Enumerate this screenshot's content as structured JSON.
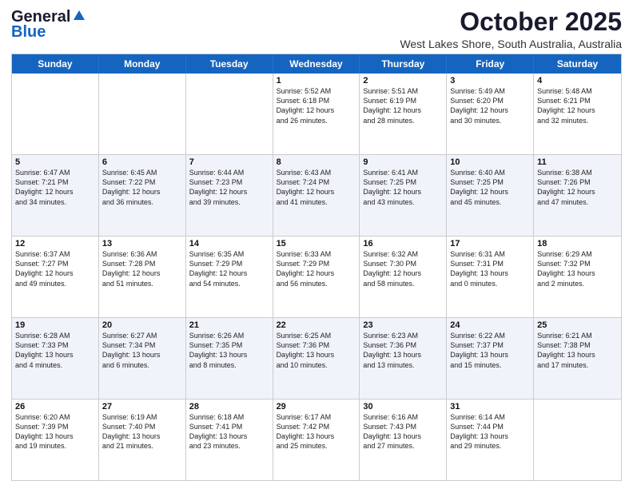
{
  "logo": {
    "line1": "General",
    "line2": "Blue"
  },
  "title": "October 2025",
  "subtitle": "West Lakes Shore, South Australia, Australia",
  "header_days": [
    "Sunday",
    "Monday",
    "Tuesday",
    "Wednesday",
    "Thursday",
    "Friday",
    "Saturday"
  ],
  "rows": [
    {
      "alt": false,
      "cells": [
        {
          "day": "",
          "lines": []
        },
        {
          "day": "",
          "lines": []
        },
        {
          "day": "",
          "lines": []
        },
        {
          "day": "1",
          "lines": [
            "Sunrise: 5:52 AM",
            "Sunset: 6:18 PM",
            "Daylight: 12 hours",
            "and 26 minutes."
          ]
        },
        {
          "day": "2",
          "lines": [
            "Sunrise: 5:51 AM",
            "Sunset: 6:19 PM",
            "Daylight: 12 hours",
            "and 28 minutes."
          ]
        },
        {
          "day": "3",
          "lines": [
            "Sunrise: 5:49 AM",
            "Sunset: 6:20 PM",
            "Daylight: 12 hours",
            "and 30 minutes."
          ]
        },
        {
          "day": "4",
          "lines": [
            "Sunrise: 5:48 AM",
            "Sunset: 6:21 PM",
            "Daylight: 12 hours",
            "and 32 minutes."
          ]
        }
      ]
    },
    {
      "alt": true,
      "cells": [
        {
          "day": "5",
          "lines": [
            "Sunrise: 6:47 AM",
            "Sunset: 7:21 PM",
            "Daylight: 12 hours",
            "and 34 minutes."
          ]
        },
        {
          "day": "6",
          "lines": [
            "Sunrise: 6:45 AM",
            "Sunset: 7:22 PM",
            "Daylight: 12 hours",
            "and 36 minutes."
          ]
        },
        {
          "day": "7",
          "lines": [
            "Sunrise: 6:44 AM",
            "Sunset: 7:23 PM",
            "Daylight: 12 hours",
            "and 39 minutes."
          ]
        },
        {
          "day": "8",
          "lines": [
            "Sunrise: 6:43 AM",
            "Sunset: 7:24 PM",
            "Daylight: 12 hours",
            "and 41 minutes."
          ]
        },
        {
          "day": "9",
          "lines": [
            "Sunrise: 6:41 AM",
            "Sunset: 7:25 PM",
            "Daylight: 12 hours",
            "and 43 minutes."
          ]
        },
        {
          "day": "10",
          "lines": [
            "Sunrise: 6:40 AM",
            "Sunset: 7:25 PM",
            "Daylight: 12 hours",
            "and 45 minutes."
          ]
        },
        {
          "day": "11",
          "lines": [
            "Sunrise: 6:38 AM",
            "Sunset: 7:26 PM",
            "Daylight: 12 hours",
            "and 47 minutes."
          ]
        }
      ]
    },
    {
      "alt": false,
      "cells": [
        {
          "day": "12",
          "lines": [
            "Sunrise: 6:37 AM",
            "Sunset: 7:27 PM",
            "Daylight: 12 hours",
            "and 49 minutes."
          ]
        },
        {
          "day": "13",
          "lines": [
            "Sunrise: 6:36 AM",
            "Sunset: 7:28 PM",
            "Daylight: 12 hours",
            "and 51 minutes."
          ]
        },
        {
          "day": "14",
          "lines": [
            "Sunrise: 6:35 AM",
            "Sunset: 7:29 PM",
            "Daylight: 12 hours",
            "and 54 minutes."
          ]
        },
        {
          "day": "15",
          "lines": [
            "Sunrise: 6:33 AM",
            "Sunset: 7:29 PM",
            "Daylight: 12 hours",
            "and 56 minutes."
          ]
        },
        {
          "day": "16",
          "lines": [
            "Sunrise: 6:32 AM",
            "Sunset: 7:30 PM",
            "Daylight: 12 hours",
            "and 58 minutes."
          ]
        },
        {
          "day": "17",
          "lines": [
            "Sunrise: 6:31 AM",
            "Sunset: 7:31 PM",
            "Daylight: 13 hours",
            "and 0 minutes."
          ]
        },
        {
          "day": "18",
          "lines": [
            "Sunrise: 6:29 AM",
            "Sunset: 7:32 PM",
            "Daylight: 13 hours",
            "and 2 minutes."
          ]
        }
      ]
    },
    {
      "alt": true,
      "cells": [
        {
          "day": "19",
          "lines": [
            "Sunrise: 6:28 AM",
            "Sunset: 7:33 PM",
            "Daylight: 13 hours",
            "and 4 minutes."
          ]
        },
        {
          "day": "20",
          "lines": [
            "Sunrise: 6:27 AM",
            "Sunset: 7:34 PM",
            "Daylight: 13 hours",
            "and 6 minutes."
          ]
        },
        {
          "day": "21",
          "lines": [
            "Sunrise: 6:26 AM",
            "Sunset: 7:35 PM",
            "Daylight: 13 hours",
            "and 8 minutes."
          ]
        },
        {
          "day": "22",
          "lines": [
            "Sunrise: 6:25 AM",
            "Sunset: 7:36 PM",
            "Daylight: 13 hours",
            "and 10 minutes."
          ]
        },
        {
          "day": "23",
          "lines": [
            "Sunrise: 6:23 AM",
            "Sunset: 7:36 PM",
            "Daylight: 13 hours",
            "and 13 minutes."
          ]
        },
        {
          "day": "24",
          "lines": [
            "Sunrise: 6:22 AM",
            "Sunset: 7:37 PM",
            "Daylight: 13 hours",
            "and 15 minutes."
          ]
        },
        {
          "day": "25",
          "lines": [
            "Sunrise: 6:21 AM",
            "Sunset: 7:38 PM",
            "Daylight: 13 hours",
            "and 17 minutes."
          ]
        }
      ]
    },
    {
      "alt": false,
      "cells": [
        {
          "day": "26",
          "lines": [
            "Sunrise: 6:20 AM",
            "Sunset: 7:39 PM",
            "Daylight: 13 hours",
            "and 19 minutes."
          ]
        },
        {
          "day": "27",
          "lines": [
            "Sunrise: 6:19 AM",
            "Sunset: 7:40 PM",
            "Daylight: 13 hours",
            "and 21 minutes."
          ]
        },
        {
          "day": "28",
          "lines": [
            "Sunrise: 6:18 AM",
            "Sunset: 7:41 PM",
            "Daylight: 13 hours",
            "and 23 minutes."
          ]
        },
        {
          "day": "29",
          "lines": [
            "Sunrise: 6:17 AM",
            "Sunset: 7:42 PM",
            "Daylight: 13 hours",
            "and 25 minutes."
          ]
        },
        {
          "day": "30",
          "lines": [
            "Sunrise: 6:16 AM",
            "Sunset: 7:43 PM",
            "Daylight: 13 hours",
            "and 27 minutes."
          ]
        },
        {
          "day": "31",
          "lines": [
            "Sunrise: 6:14 AM",
            "Sunset: 7:44 PM",
            "Daylight: 13 hours",
            "and 29 minutes."
          ]
        },
        {
          "day": "",
          "lines": []
        }
      ]
    }
  ]
}
